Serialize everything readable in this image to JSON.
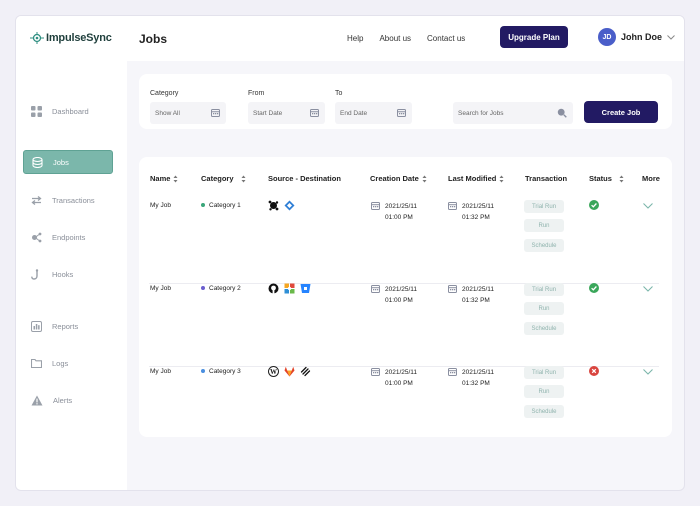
{
  "app": {
    "logo_text": "ImpulseSync",
    "page_title": "Jobs"
  },
  "topnav": {
    "items": [
      "Help",
      "About us",
      "Contact us"
    ],
    "upgrade_label": "Upgrade Plan"
  },
  "user": {
    "initials": "JD",
    "name": "John Doe"
  },
  "sidebar": {
    "items": [
      {
        "label": "Dashboard",
        "icon": "grid-icon"
      },
      {
        "label": "Jobs",
        "icon": "database-icon",
        "active": true
      },
      {
        "label": "Transactions",
        "icon": "transactions-icon"
      },
      {
        "label": "Endpoints",
        "icon": "endpoints-icon"
      },
      {
        "label": "Hooks",
        "icon": "hook-icon"
      },
      {
        "label": "Reports",
        "icon": "report-icon"
      },
      {
        "label": "Logs",
        "icon": "folder-icon"
      },
      {
        "label": "Alerts",
        "icon": "warning-icon"
      }
    ]
  },
  "filters": {
    "category_label": "Category",
    "category_value": "Show All",
    "from_label": "From",
    "from_placeholder": "Start Date",
    "to_label": "To",
    "to_placeholder": "End Date",
    "search_placeholder": "Search for Jobs",
    "create_label": "Create Job"
  },
  "table": {
    "headers": [
      "Name",
      "Category",
      "Source - Destination",
      "Creation Date",
      "Last Modified",
      "Transaction",
      "Status",
      "More"
    ],
    "transaction_buttons": [
      "Trial Run",
      "Run",
      "Schedule"
    ],
    "rows": [
      {
        "name": "My Job",
        "category": "Category 1",
        "category_color": "#3aa67a",
        "sources": [
          "bot-icon",
          "drive-icon"
        ],
        "created_date": "2021/25/11",
        "created_time": "01:00 PM",
        "modified_date": "2021/25/11",
        "modified_time": "01:32 PM",
        "status": "success"
      },
      {
        "name": "My Job",
        "category": "Category 2",
        "category_color": "#6a5ecf",
        "sources": [
          "github-icon",
          "joomla-icon",
          "bitbucket-icon"
        ],
        "created_date": "2021/25/11",
        "created_time": "01:00 PM",
        "modified_date": "2021/25/11",
        "modified_time": "01:32 PM",
        "status": "success"
      },
      {
        "name": "My Job",
        "category": "Category 3",
        "category_color": "#4a8fe0",
        "sources": [
          "wordpress-icon",
          "gitlab-icon",
          "squarespace-icon"
        ],
        "created_date": "2021/25/11",
        "created_time": "01:00 PM",
        "modified_date": "2021/25/11",
        "modified_time": "01:32 PM",
        "status": "error"
      }
    ]
  },
  "colors": {
    "primary": "#221a63",
    "accent": "#7bb7ab",
    "success": "#3aa65a",
    "error": "#d9453f"
  }
}
